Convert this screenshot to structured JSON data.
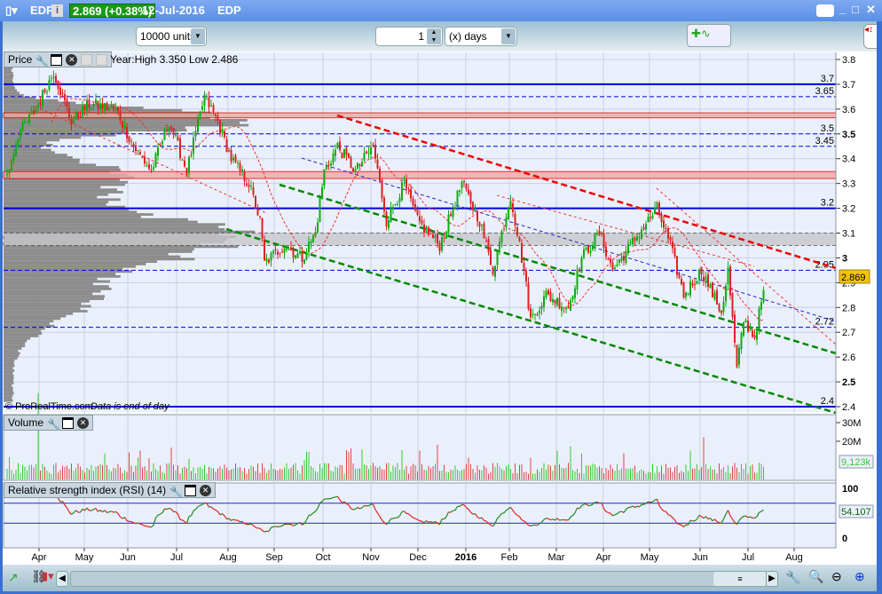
{
  "window": {
    "symbol": "EDP",
    "price_badge": "2.869 (+0.38%)",
    "date": "12-Jul-2016",
    "name": "EDP",
    "info": "i",
    "controls": [
      "keyboard-icon",
      "minimize",
      "maximize",
      "close"
    ]
  },
  "toolbar": {
    "units": "10000 units",
    "period_value": "1",
    "period_unit": "(x) days"
  },
  "price_panel": {
    "title": "Price",
    "year_info": "Year:High 3.350 Low 2.486",
    "copyright": "© ProRealTime.com",
    "data_note": "Data is end of day",
    "current_price": "2.869",
    "levels": [
      {
        "label": "3.7",
        "value": 3.7,
        "style": "solid"
      },
      {
        "label": "3.65",
        "value": 3.65,
        "style": "dashed"
      },
      {
        "label": "3.5",
        "value": 3.5,
        "style": "dashed"
      },
      {
        "label": "3.45",
        "value": 3.45,
        "style": "dashed"
      },
      {
        "label": "3.2",
        "value": 3.2,
        "style": "solid"
      },
      {
        "label": "2.95",
        "value": 2.95,
        "style": "dashed"
      },
      {
        "label": "2.72",
        "value": 2.72,
        "style": "dashed"
      },
      {
        "label": "2.4",
        "value": 2.4,
        "style": "solid"
      }
    ],
    "zones": [
      {
        "from": 3.565,
        "to": 3.585,
        "color": "#f4a6a6"
      },
      {
        "from": 3.32,
        "to": 3.348,
        "color": "#f4a6a6"
      },
      {
        "from": 3.05,
        "to": 3.1,
        "color": "#c8c8cc"
      }
    ],
    "y_ticks": [
      "3.8",
      "3.7",
      "3.6",
      "3.5",
      "3.4",
      "3.3",
      "3.2",
      "3.1",
      "3",
      "2.9",
      "2.8",
      "2.7",
      "2.6",
      "2.5",
      "2.4"
    ]
  },
  "volume_panel": {
    "title": "Volume",
    "y_ticks": [
      "30M",
      "20M"
    ],
    "last_value": "9,123k"
  },
  "rsi_panel": {
    "title": "Relative strength index (RSI) (14)",
    "y_ticks": [
      "100",
      "0"
    ],
    "last_value": "54.107",
    "overbought": 70,
    "oversold": 30
  },
  "x_axis": {
    "labels": [
      "Apr",
      "May",
      "Jun",
      "Jul",
      "Aug",
      "Sep",
      "Oct",
      "Nov",
      "Dec",
      "2016",
      "Feb",
      "Mar",
      "Apr",
      "May",
      "Jun",
      "Jul",
      "Aug"
    ]
  },
  "chart_data": {
    "type": "candlestick",
    "ylim": [
      2.4,
      3.8
    ],
    "price_anchors": [
      [
        0,
        3.33
      ],
      [
        5,
        3.5
      ],
      [
        13,
        3.6
      ],
      [
        21,
        3.75
      ],
      [
        29,
        3.55
      ],
      [
        37,
        3.62
      ],
      [
        49,
        3.6
      ],
      [
        57,
        3.45
      ],
      [
        65,
        3.35
      ],
      [
        73,
        3.55
      ],
      [
        81,
        3.35
      ],
      [
        89,
        3.65
      ],
      [
        95,
        3.55
      ],
      [
        101,
        3.4
      ],
      [
        109,
        3.3
      ],
      [
        114,
        3.15
      ],
      [
        116,
        2.98
      ],
      [
        125,
        3.05
      ],
      [
        133,
        3.0
      ],
      [
        139,
        3.1
      ],
      [
        143,
        3.35
      ],
      [
        149,
        3.45
      ],
      [
        157,
        3.35
      ],
      [
        165,
        3.45
      ],
      [
        171,
        3.15
      ],
      [
        179,
        3.3
      ],
      [
        185,
        3.15
      ],
      [
        195,
        3.05
      ],
      [
        205,
        3.3
      ],
      [
        213,
        3.15
      ],
      [
        219,
        2.95
      ],
      [
        227,
        3.25
      ],
      [
        233,
        2.95
      ],
      [
        236,
        2.75
      ],
      [
        243,
        2.85
      ],
      [
        253,
        2.8
      ],
      [
        259,
        3.0
      ],
      [
        267,
        3.1
      ],
      [
        273,
        2.95
      ],
      [
        281,
        3.05
      ],
      [
        293,
        3.2
      ],
      [
        299,
        3.05
      ],
      [
        305,
        2.85
      ],
      [
        313,
        2.95
      ],
      [
        322,
        2.78
      ],
      [
        325,
        2.95
      ],
      [
        329,
        2.55
      ],
      [
        332,
        2.75
      ],
      [
        337,
        2.68
      ],
      [
        341,
        2.869
      ]
    ]
  }
}
